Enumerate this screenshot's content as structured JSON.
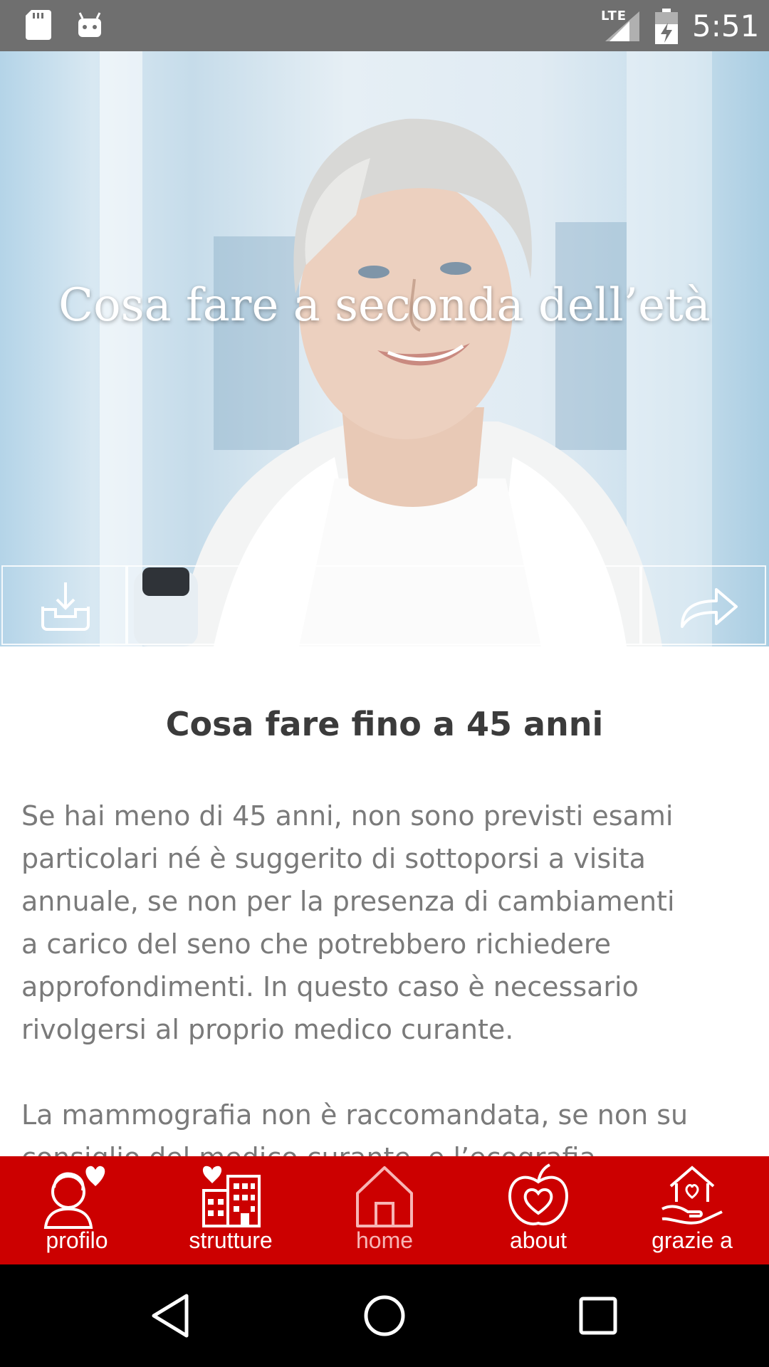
{
  "status_bar": {
    "network": "LTE",
    "time": "5:51",
    "icons": [
      "sd-card-icon",
      "android-icon",
      "signal-icon",
      "battery-icon"
    ]
  },
  "hero": {
    "title": "Cosa fare a seconda dell’età",
    "actions": [
      "download-icon",
      "share-icon"
    ]
  },
  "article": {
    "heading": "Cosa fare fino a 45 anni",
    "paragraphs": [
      "Se hai meno di 45 anni, non sono previsti esami particolari né è suggerito di sottoporsi a visita annuale, se non per la presenza di cambiamenti a carico del seno che potrebbero richiedere approfondimenti. In questo caso è necessario rivolgersi al proprio medico curante.",
      "La mammografia non è raccomandata, se non su consiglio del medico curante, e l’ecografia"
    ]
  },
  "bottom_nav": {
    "items": [
      {
        "label": "profilo",
        "icon": "profile-heart-icon"
      },
      {
        "label": "strutture",
        "icon": "buildings-icon"
      },
      {
        "label": "home",
        "icon": "home-icon",
        "active": true
      },
      {
        "label": "about",
        "icon": "apple-heart-icon"
      },
      {
        "label": "grazie a",
        "icon": "hands-house-icon"
      }
    ]
  },
  "colors": {
    "nav_background": "#cc0000",
    "status_bar": "#6f6f6f",
    "heading_text": "#3b3b3b",
    "body_text": "#7a7a7a",
    "active_nav": "#f7b5b5"
  }
}
